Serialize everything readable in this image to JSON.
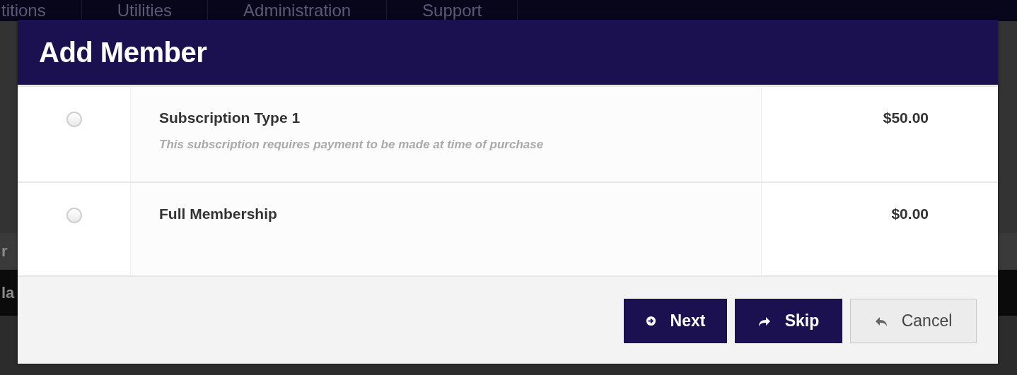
{
  "nav": [
    {
      "label": "titions"
    },
    {
      "label": "Utilities"
    },
    {
      "label": "Administration"
    },
    {
      "label": "Support"
    }
  ],
  "background_fragments": [
    {
      "text": "r",
      "kind": "plain"
    },
    {
      "text": "la",
      "kind": "bar"
    }
  ],
  "dialog": {
    "title": "Add Member",
    "options": [
      {
        "name": "Subscription Type 1",
        "note": "This subscription requires payment to be made at time of purchase",
        "price": "$50.00",
        "selected": false
      },
      {
        "name": "Full Membership",
        "price": "$0.00",
        "selected": false
      }
    ],
    "buttons": [
      {
        "label": "Next",
        "kind": "next"
      },
      {
        "label": "Skip",
        "kind": "skip"
      },
      {
        "label": "Cancel",
        "kind": "cancel"
      }
    ]
  }
}
